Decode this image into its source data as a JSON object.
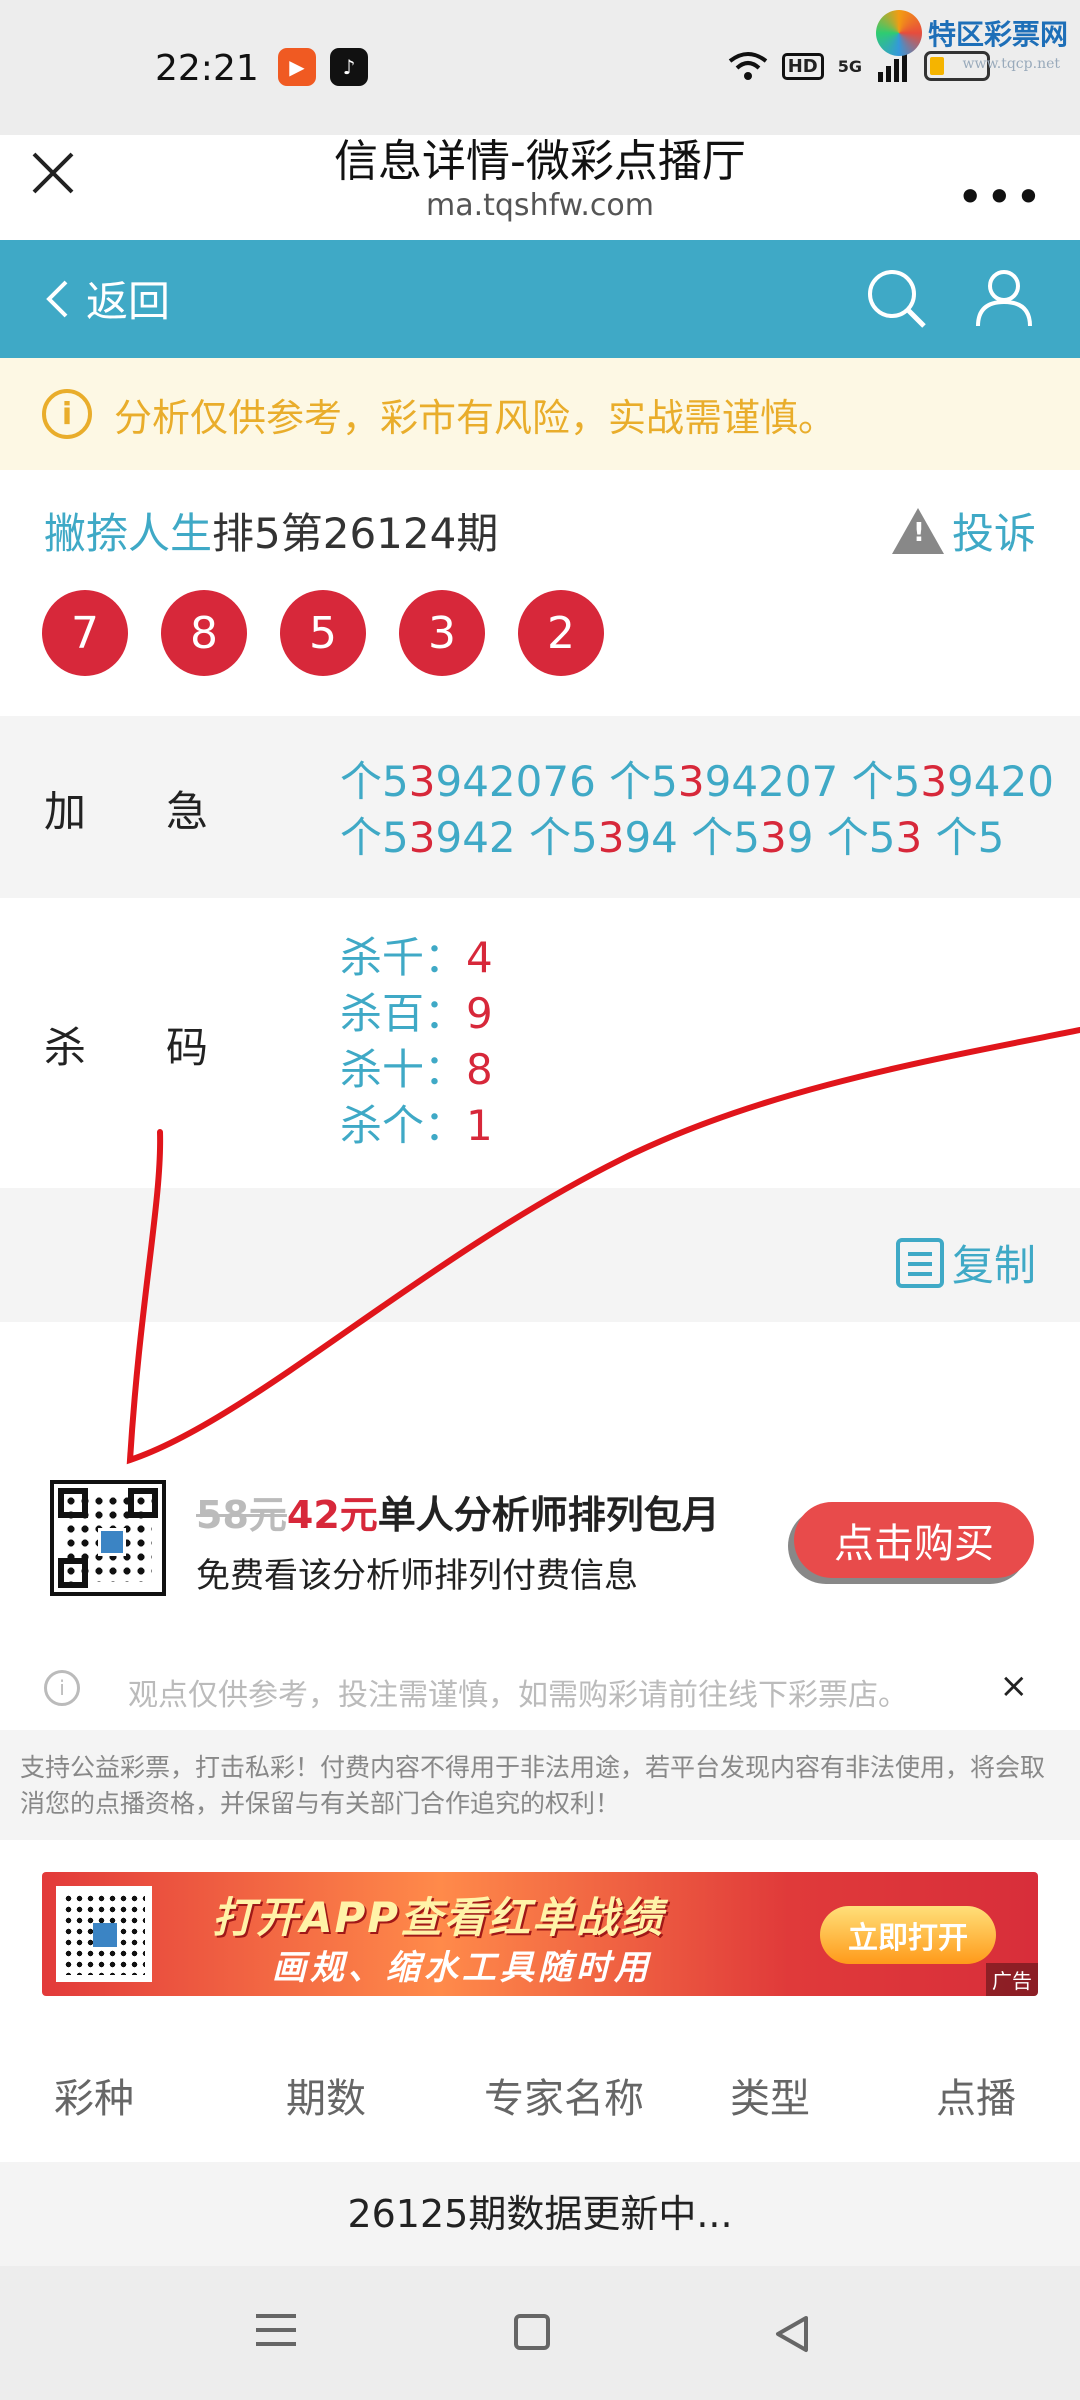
{
  "status_bar": {
    "time": "22:21",
    "hd": "HD",
    "network": "5G",
    "watermark_title": "特区彩票网",
    "watermark_sub": "www.tqcp.net"
  },
  "browser": {
    "title": "信息详情-微彩点播厅",
    "url": "ma.tqshfw.com",
    "more": "•••"
  },
  "nav": {
    "back_label": "返回"
  },
  "notice": {
    "icon": "i",
    "text": "分析仅供参考，彩市有风险，实战需谨慎。"
  },
  "expert": {
    "name": "撇捺人生",
    "issue": "排5第26124期",
    "complain_label": "投诉",
    "balls": [
      "7",
      "8",
      "5",
      "3",
      "2"
    ]
  },
  "jiaji": {
    "label": "加急",
    "line1": [
      {
        "pre": "个5",
        "hl": "3",
        "post": "942076"
      },
      {
        "pre": " 个5",
        "hl": "3",
        "post": "94207"
      },
      {
        "pre": " 个5",
        "hl": "3",
        "post": "9420"
      }
    ],
    "line2": [
      {
        "pre": "个5",
        "hl": "3",
        "post": "942"
      },
      {
        "pre": " 个5",
        "hl": "3",
        "post": "94"
      },
      {
        "pre": " 个5",
        "hl": "3",
        "post": "9"
      },
      {
        "pre": " 个5",
        "hl": "3",
        "post": ""
      },
      {
        "pre": " 个5",
        "hl": "",
        "post": ""
      }
    ]
  },
  "shama": {
    "label": "杀码",
    "items": [
      {
        "key": "杀千：",
        "val": "4"
      },
      {
        "key": "杀百：",
        "val": "9"
      },
      {
        "key": "杀十：",
        "val": "8"
      },
      {
        "key": "杀个：",
        "val": "1"
      }
    ]
  },
  "copy_label": "复制",
  "promo": {
    "old_price": "58元",
    "new_price": "42元",
    "title": "单人分析师排列包月",
    "subtitle": "免费看该分析师排列付费信息",
    "buy_label": "点击购买"
  },
  "disclaimer": {
    "text": "观点仅供参考，投注需谨慎，如需购彩请前往线下彩票店。",
    "close": "×"
  },
  "legal_notice": "支持公益彩票，打击私彩！付费内容不得用于非法用途，若平台发现内容有非法使用，将会取消您的点播资格，并保留与有关部门合作追究的权利！",
  "ad": {
    "title": "打开APP查看红单战绩",
    "subtitle": "画规、缩水工具随时用",
    "button": "立即打开",
    "tag": "广告"
  },
  "table": {
    "headers": [
      "彩种",
      "期数",
      "专家名称",
      "类型",
      "点播"
    ]
  },
  "updating_text": "26125期数据更新中...",
  "colors": {
    "teal": "#3fa9c6",
    "red": "#d7283a",
    "notice_yellow": "#e9ad2b"
  }
}
